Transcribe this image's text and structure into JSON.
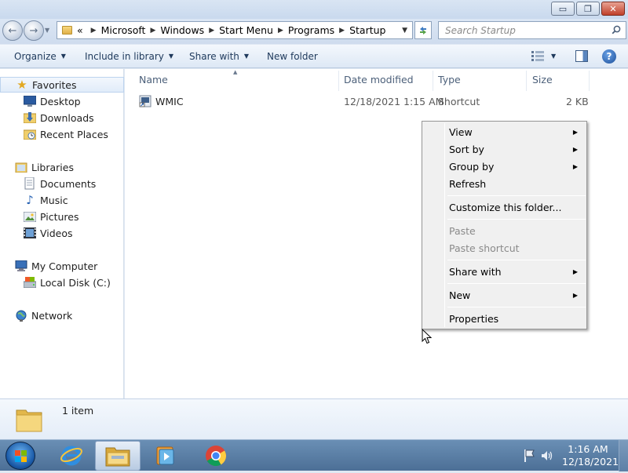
{
  "window": {
    "caption_buttons": {
      "minimize": "▭",
      "maximize": "❐",
      "close": "✕"
    }
  },
  "address": {
    "overflow": "«",
    "crumbs": [
      "Microsoft",
      "Windows",
      "Start Menu",
      "Programs",
      "Startup"
    ]
  },
  "search": {
    "placeholder": "Search Startup"
  },
  "toolbar": {
    "organize": "Organize",
    "include_in_library": "Include in library",
    "share_with": "Share with",
    "new_folder": "New folder",
    "help": "?"
  },
  "nav": {
    "favorites": {
      "label": "Favorites",
      "items": [
        "Desktop",
        "Downloads",
        "Recent Places"
      ]
    },
    "libraries": {
      "label": "Libraries",
      "items": [
        "Documents",
        "Music",
        "Pictures",
        "Videos"
      ]
    },
    "computer": {
      "label": "My Computer",
      "items": [
        "Local Disk (C:)"
      ]
    },
    "network": {
      "label": "Network"
    }
  },
  "file_list": {
    "columns": [
      "Name",
      "Date modified",
      "Type",
      "Size"
    ],
    "rows": [
      {
        "name": "WMIC",
        "date_modified": "12/18/2021 1:15 AM",
        "type": "Shortcut",
        "size": "2 KB"
      }
    ]
  },
  "context_menu": {
    "items": [
      {
        "label": "View",
        "submenu": true,
        "enabled": true
      },
      {
        "label": "Sort by",
        "submenu": true,
        "enabled": true
      },
      {
        "label": "Group by",
        "submenu": true,
        "enabled": true
      },
      {
        "label": "Refresh",
        "submenu": false,
        "enabled": true
      },
      {
        "label": "Customize this folder...",
        "submenu": false,
        "enabled": true
      },
      {
        "label": "Paste",
        "submenu": false,
        "enabled": false
      },
      {
        "label": "Paste shortcut",
        "submenu": false,
        "enabled": false
      },
      {
        "label": "Share with",
        "submenu": true,
        "enabled": true
      },
      {
        "label": "New",
        "submenu": true,
        "enabled": true
      },
      {
        "label": "Properties",
        "submenu": false,
        "enabled": true
      }
    ]
  },
  "details_pane": {
    "item_count": "1 item"
  },
  "taskbar": {
    "pinned": [
      "internet-explorer-icon",
      "windows-explorer-icon",
      "media-player-icon",
      "chrome-icon"
    ],
    "clock_time": "1:16 AM",
    "clock_date": "12/18/2021"
  },
  "colors": {
    "accent": "#1e395b",
    "taskbar": "#4c6f96",
    "menu_background": "#f0f0f0",
    "disabled_text": "#8a8a8a"
  }
}
